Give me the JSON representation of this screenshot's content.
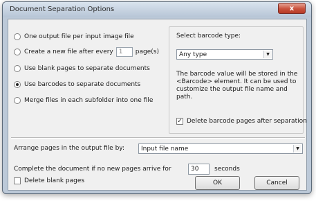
{
  "window": {
    "title": "Document Separation Options",
    "close_glyph": "x"
  },
  "options": {
    "one_file_per_image": "One output file per input image file",
    "new_file_every_prefix": "Create a new file after every",
    "new_file_every_value": "1",
    "new_file_every_suffix": "page(s)",
    "blank_pages": "Use blank pages to separate documents",
    "barcodes": "Use barcodes to separate documents",
    "merge_subfolder": "Merge files in each subfolder into one file",
    "selected": "barcodes"
  },
  "barcode_group": {
    "title": "Select barcode type:",
    "type_value": "Any type",
    "description": "The barcode value will be stored in the <Barcode> element. It can be used to customize the output file name and path.",
    "delete_after_label": "Delete barcode pages after separation",
    "delete_after_checked": true
  },
  "arrange": {
    "label": "Arrange pages in the output file by:",
    "value": "Input file name"
  },
  "complete": {
    "prefix": "Complete the document if no new pages arrive for",
    "value": "30",
    "suffix": "seconds"
  },
  "delete_blank": {
    "label": "Delete blank pages",
    "checked": false
  },
  "buttons": {
    "ok": "OK",
    "cancel": "Cancel"
  }
}
